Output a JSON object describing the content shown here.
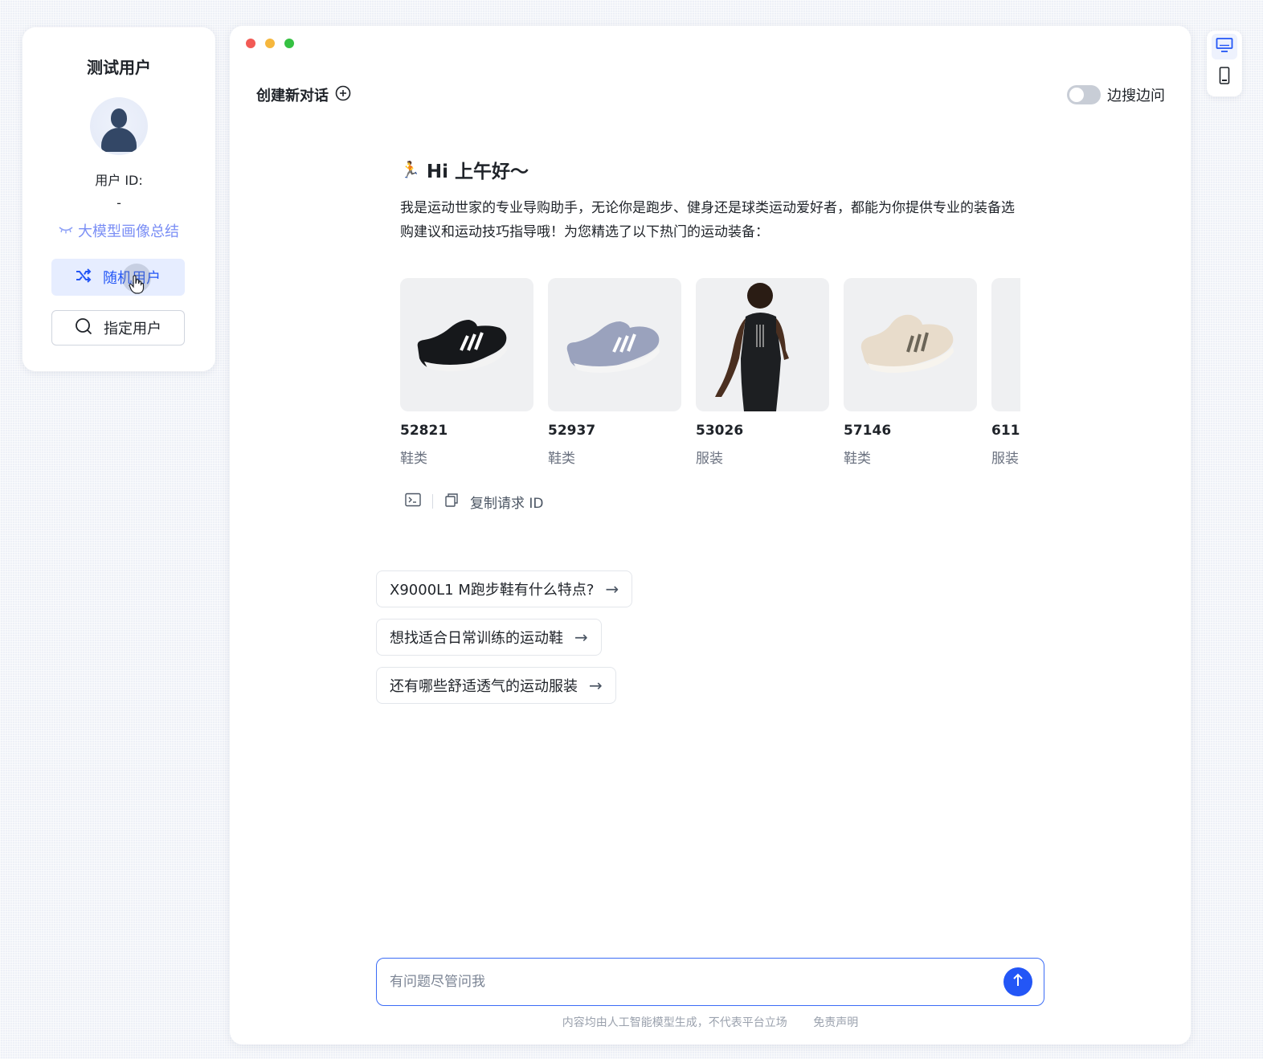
{
  "user_panel": {
    "title": "测试用户",
    "user_id_label": "用户 ID:",
    "user_id_value": "-",
    "portrait_summary": "大模型画像总结",
    "random_user": "随机用户",
    "assign_user": "指定用户"
  },
  "header": {
    "new_chat": "创建新对话",
    "toggle_label": "边搜边问",
    "toggle_on": false
  },
  "greeting": {
    "emoji": "🏃",
    "title": "Hi 上午好～",
    "intro": "我是运动世家的专业导购助手，无论你是跑步、健身还是球类运动爱好者，都能为你提供专业的装备选购建议和运动技巧指导哦！为您精选了以下热门的运动装备："
  },
  "products": [
    {
      "id": "52821",
      "category": "鞋类",
      "image": "black-running-shoe"
    },
    {
      "id": "52937",
      "category": "鞋类",
      "image": "grey-running-shoe"
    },
    {
      "id": "53026",
      "category": "服装",
      "image": "black-tank-top"
    },
    {
      "id": "57146",
      "category": "鞋类",
      "image": "beige-running-shoe"
    },
    {
      "id": "611",
      "category": "服装",
      "image": "partial-item"
    }
  ],
  "actions": {
    "copy_request_id": "复制请求 ID"
  },
  "suggestions": [
    "X9000L1 M跑步鞋有什么特点?",
    "想找适合日常训练的运动鞋",
    "还有哪些舒适透气的运动服装"
  ],
  "input": {
    "placeholder": "有问题尽管问我",
    "value": ""
  },
  "footer": {
    "notice": "内容均由人工智能模型生成，不代表平台立场",
    "disclaimer": "免责声明"
  },
  "colors": {
    "accent": "#2356f6",
    "accent_light": "#e6edff"
  },
  "icons": {
    "random": "shuffle-icon",
    "assign": "search-icon",
    "new_chat": "plus-circle-icon",
    "send": "arrow-up-icon"
  }
}
